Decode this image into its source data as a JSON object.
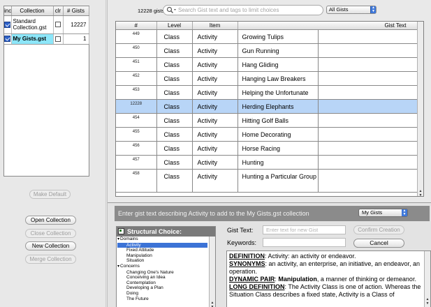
{
  "collections": {
    "headers": [
      "inc",
      "Collection",
      "clr",
      "# Gists"
    ],
    "rows": [
      {
        "name": "Standard Collection.gst",
        "name_line1": "Standard",
        "name_line2": "Collection.gst",
        "count": "12227"
      },
      {
        "name": "My Gists.gst",
        "count": "1"
      }
    ],
    "buttons": {
      "make_default": "Make Default",
      "open": "Open Collection",
      "close": "Close Collection",
      "new": "New Collection",
      "merge": "Merge Collection"
    }
  },
  "toolbar": {
    "gist_count": "12228 gists",
    "search_placeholder": "Search Gist text and tags to limit choices",
    "filter_value": "All Gists"
  },
  "gists": {
    "headers": [
      "#",
      "Level",
      "Item",
      "Gist Text"
    ],
    "rows": [
      {
        "num": "449",
        "level": "Class",
        "item": "Activity",
        "text": "Growing Tulips"
      },
      {
        "num": "450",
        "level": "Class",
        "item": "Activity",
        "text": "Gun Running"
      },
      {
        "num": "451",
        "level": "Class",
        "item": "Activity",
        "text": "Hang Gliding"
      },
      {
        "num": "452",
        "level": "Class",
        "item": "Activity",
        "text": "Hanging Law Breakers"
      },
      {
        "num": "453",
        "level": "Class",
        "item": "Activity",
        "text": "Helping the Unfortunate"
      },
      {
        "num": "12228",
        "level": "Class",
        "item": "Activity",
        "text": "Herding Elephants"
      },
      {
        "num": "454",
        "level": "Class",
        "item": "Activity",
        "text": "Hitting Golf Balls"
      },
      {
        "num": "455",
        "level": "Class",
        "item": "Activity",
        "text": "Home Decorating"
      },
      {
        "num": "456",
        "level": "Class",
        "item": "Activity",
        "text": "Horse Racing"
      },
      {
        "num": "457",
        "level": "Class",
        "item": "Activity",
        "text": "Hunting"
      },
      {
        "num": "458",
        "level": "Class",
        "item": "Activity",
        "text": "Hunting a Particular Group"
      }
    ]
  },
  "editor": {
    "banner": "Enter gist text describing Activity to add to the My Gists.gst collection",
    "target_value": "My Gists",
    "choice_title": "Structural Choice:",
    "choice_tree": [
      {
        "label": "Domains",
        "group": true
      },
      {
        "label": "Activity",
        "selected": true
      },
      {
        "label": "Fixed Attitude"
      },
      {
        "label": "Manipulation"
      },
      {
        "label": "Situation"
      },
      {
        "label": "Concerns",
        "group": true
      },
      {
        "label": "Changing One's Nature"
      },
      {
        "label": "Conceiving an Idea"
      },
      {
        "label": "Contemplation"
      },
      {
        "label": "Developing a Plan"
      },
      {
        "label": "Doing"
      },
      {
        "label": "The Future"
      }
    ],
    "gist_text_label": "Gist Text:",
    "gist_text_placeholder": "Enter text for new Gist",
    "keywords_label": "Keywords:",
    "confirm_label": "Confirm Creation",
    "cancel_label": "Cancel",
    "definition": {
      "def_label": "DEFINITION",
      "def_text": ":  Activity:  an activity or endeavor.",
      "syn_label": "SYNONYMS",
      "syn_text": ":  an activity, an enterprise, an initiative, an endeavor, an operation.",
      "pair_label": "DYNAMIC PAIR",
      "pair_text": ":  ",
      "pair_bold": "Manipulation",
      "pair_rest": ", a manner of thinking or demeanor.",
      "long_label": "LONG DEFINITION",
      "long_text": ":  The Activity Class is one of action.  Whereas the Situation Class describes a fixed state, Activity is a Class of"
    }
  }
}
